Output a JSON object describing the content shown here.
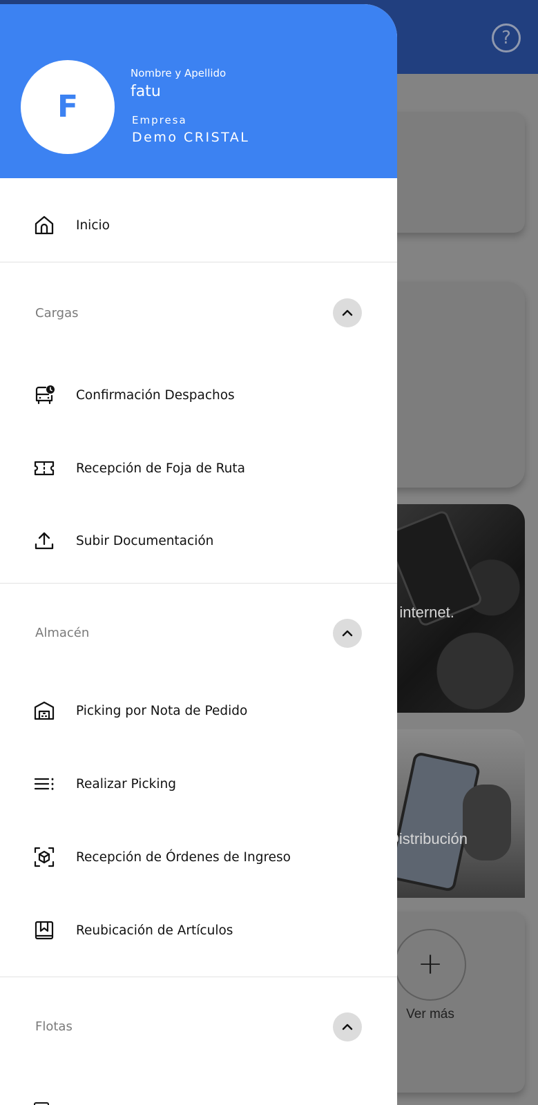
{
  "background": {
    "help_glyph": "?",
    "photo1_text": "a internet.",
    "photo2_text": "Distribución",
    "add_glyph": "+",
    "ver_mas": "Ver más"
  },
  "drawer": {
    "avatar_initial": "F",
    "name_label": "Nombre y Apellido",
    "name": "fatu",
    "company_label": "Empresa",
    "company": "Demo CRISTAL",
    "home": {
      "label": "Inicio",
      "icon": "home-icon"
    },
    "sections": [
      {
        "title": "Cargas",
        "expanded": true,
        "items": [
          {
            "label": "Confirmación Despachos",
            "icon": "bus-clock-icon"
          },
          {
            "label": "Recepción de Foja de Ruta",
            "icon": "ticket-icon"
          },
          {
            "label": "Subir Documentación",
            "icon": "upload-icon"
          }
        ]
      },
      {
        "title": "Almacén",
        "expanded": true,
        "items": [
          {
            "label": "Picking por Nota de Pedido",
            "icon": "warehouse-icon"
          },
          {
            "label": "Realizar Picking",
            "icon": "list-icon"
          },
          {
            "label": "Recepción de Órdenes de Ingreso",
            "icon": "box-scan-icon"
          },
          {
            "label": "Reubicación de Artículos",
            "icon": "bookmark-box-icon"
          }
        ]
      },
      {
        "title": "Flotas",
        "expanded": true,
        "items": []
      }
    ]
  },
  "colors": {
    "header_blue": "#3c82f2",
    "topbar_navy": "#213f7f",
    "scrim_gray": "#838383"
  }
}
